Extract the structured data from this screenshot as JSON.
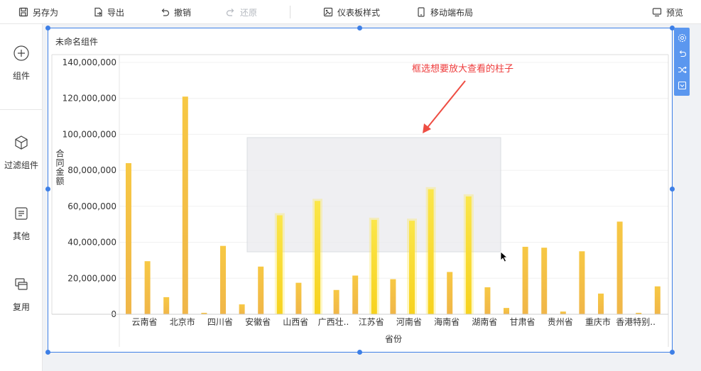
{
  "toolbar": {
    "save_as": "另存为",
    "export": "导出",
    "undo": "撤销",
    "redo": "还原",
    "dashboard_style": "仪表板样式",
    "mobile_layout": "移动端布局",
    "preview": "预览"
  },
  "sidebar": {
    "items": [
      {
        "label": "组件",
        "icon": "plus-circle-icon"
      },
      {
        "label": "过滤组件",
        "icon": "cube-icon"
      },
      {
        "label": "其他",
        "icon": "document-icon"
      },
      {
        "label": "复用",
        "icon": "copy-icon"
      }
    ]
  },
  "widget": {
    "title": "未命名组件",
    "tools": [
      "settings-icon",
      "undo-icon",
      "shuffle-icon",
      "collapse-icon"
    ]
  },
  "annotation": "框选想要放大查看的柱子",
  "colors": {
    "accent": "#3d7fe6",
    "bar_normal": "#f2c044",
    "bar_highlight": "#fbdf2a",
    "annotation": "#ee3b3b",
    "selection_fill": "#e9eaed"
  },
  "chart_data": {
    "type": "bar",
    "xlabel": "省份",
    "ylabel": "合同金额",
    "ylim": [
      0,
      140000000
    ],
    "yticks": [
      "0",
      "20,000,000",
      "40,000,000",
      "60,000,000",
      "80,000,000",
      "100,000,000",
      "120,000,000",
      "140,000,000"
    ],
    "tick_labels": [
      "云南省",
      "北京市",
      "四川省",
      "安徽省",
      "山西省",
      "广西壮..",
      "江苏省",
      "河南省",
      "海南省",
      "湖南省",
      "甘肃省",
      "贵州省",
      "重庆市",
      "香港特别.."
    ],
    "values": [
      84000000,
      29500000,
      9500000,
      121000000,
      800000,
      38000000,
      5500000,
      26500000,
      55000000,
      17500000,
      63000000,
      13500000,
      21500000,
      52500000,
      19500000,
      52000000,
      69500000,
      23500000,
      65500000,
      15000000,
      3500000,
      37500000,
      37000000,
      1500000,
      35000000,
      11500000,
      51500000,
      800000,
      15500000
    ],
    "highlighted": [
      8,
      10,
      13,
      15,
      16,
      18
    ]
  }
}
